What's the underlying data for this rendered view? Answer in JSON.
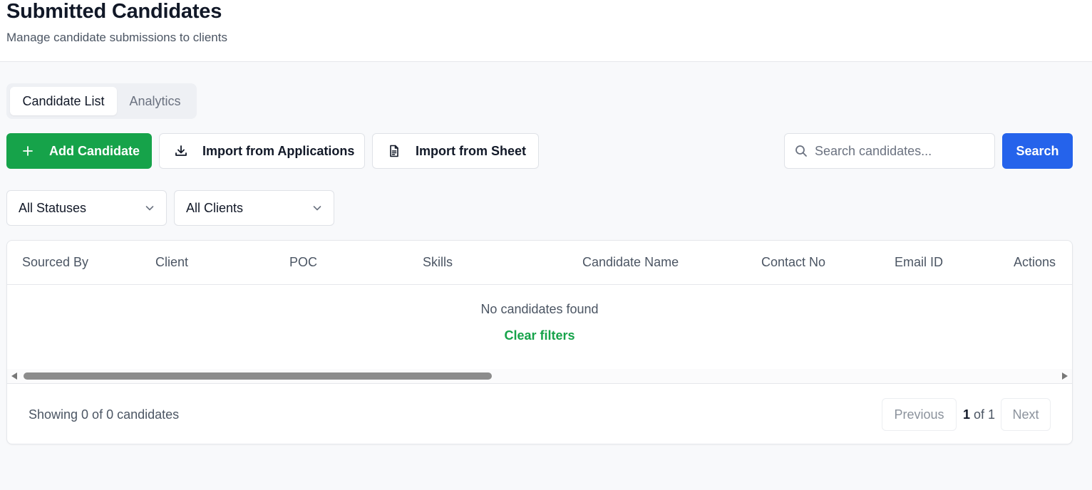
{
  "header": {
    "title": "Submitted Candidates",
    "subtitle": "Manage candidate submissions to clients"
  },
  "tabs": [
    {
      "label": "Candidate List",
      "active": true
    },
    {
      "label": "Analytics",
      "active": false
    }
  ],
  "toolbar": {
    "add_label": "Add Candidate",
    "import_apps_label": "Import from Applications",
    "import_sheet_label": "Import from Sheet",
    "search_placeholder": "Search candidates...",
    "search_value": "",
    "search_button": "Search"
  },
  "filters": {
    "status": "All Statuses",
    "client": "All Clients"
  },
  "table": {
    "columns": [
      "Sourced By",
      "Client",
      "POC",
      "Skills",
      "Candidate Name",
      "Contact No",
      "Email ID",
      "Actions"
    ],
    "rows": [],
    "empty_message": "No candidates found",
    "clear_filters": "Clear filters"
  },
  "footer": {
    "showing": "Showing 0 of 0 candidates",
    "previous": "Previous",
    "next": "Next",
    "current_page": "1",
    "page_of": "of 1"
  },
  "colors": {
    "primary_green": "#16a34a",
    "primary_blue": "#2563eb"
  },
  "icons": {
    "add": "plus-icon",
    "import_apps": "download-icon",
    "import_sheet": "file-text-icon",
    "search": "search-icon",
    "dropdown": "chevron-down-icon"
  }
}
